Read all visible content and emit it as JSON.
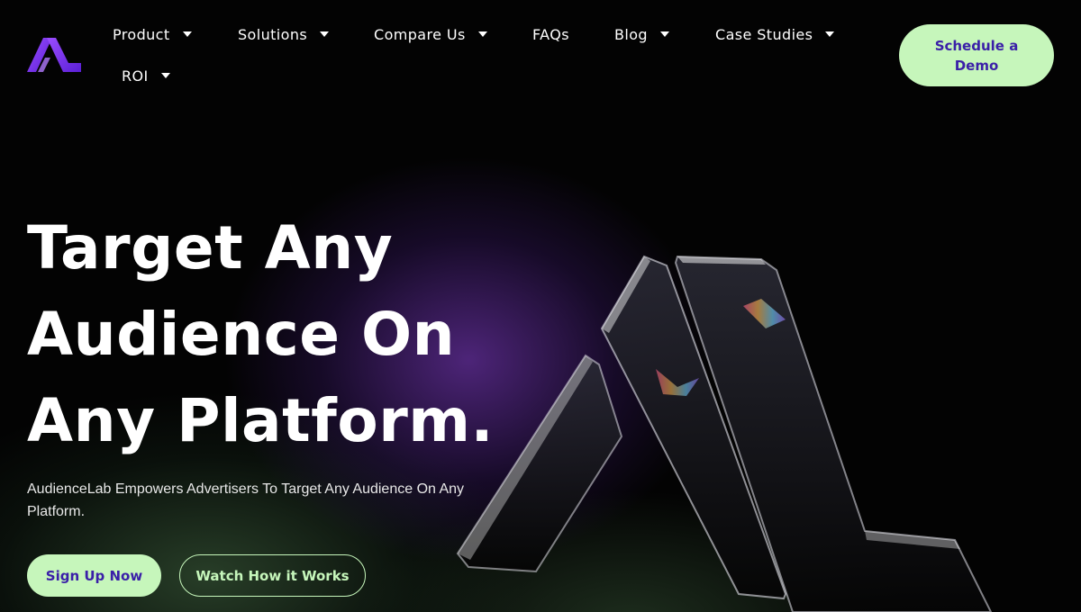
{
  "brand": {
    "logo_icon": "audiencelab-logo-icon",
    "accent_color": "#7b2ff7",
    "cta_color": "#c6f6bb",
    "cta_text_color": "#3a1fa8"
  },
  "nav": {
    "items": [
      {
        "label": "Product",
        "has_dropdown": true
      },
      {
        "label": "Solutions",
        "has_dropdown": true
      },
      {
        "label": "Compare Us",
        "has_dropdown": true
      },
      {
        "label": "FAQs",
        "has_dropdown": false
      },
      {
        "label": "Blog",
        "has_dropdown": true
      },
      {
        "label": "Case Studies",
        "has_dropdown": true
      },
      {
        "label": "ROI",
        "has_dropdown": true
      }
    ],
    "schedule_label": "Schedule a Demo"
  },
  "hero": {
    "title_lines": [
      "Target Any",
      "Audience On",
      "Any Platform."
    ],
    "subtitle": "AudienceLab Empowers Advertisers To Target Any Audience On Any Platform.",
    "primary_cta": "Sign Up Now",
    "secondary_cta": "Watch How it Works",
    "art_icon": "glass-logo-sculpture"
  }
}
